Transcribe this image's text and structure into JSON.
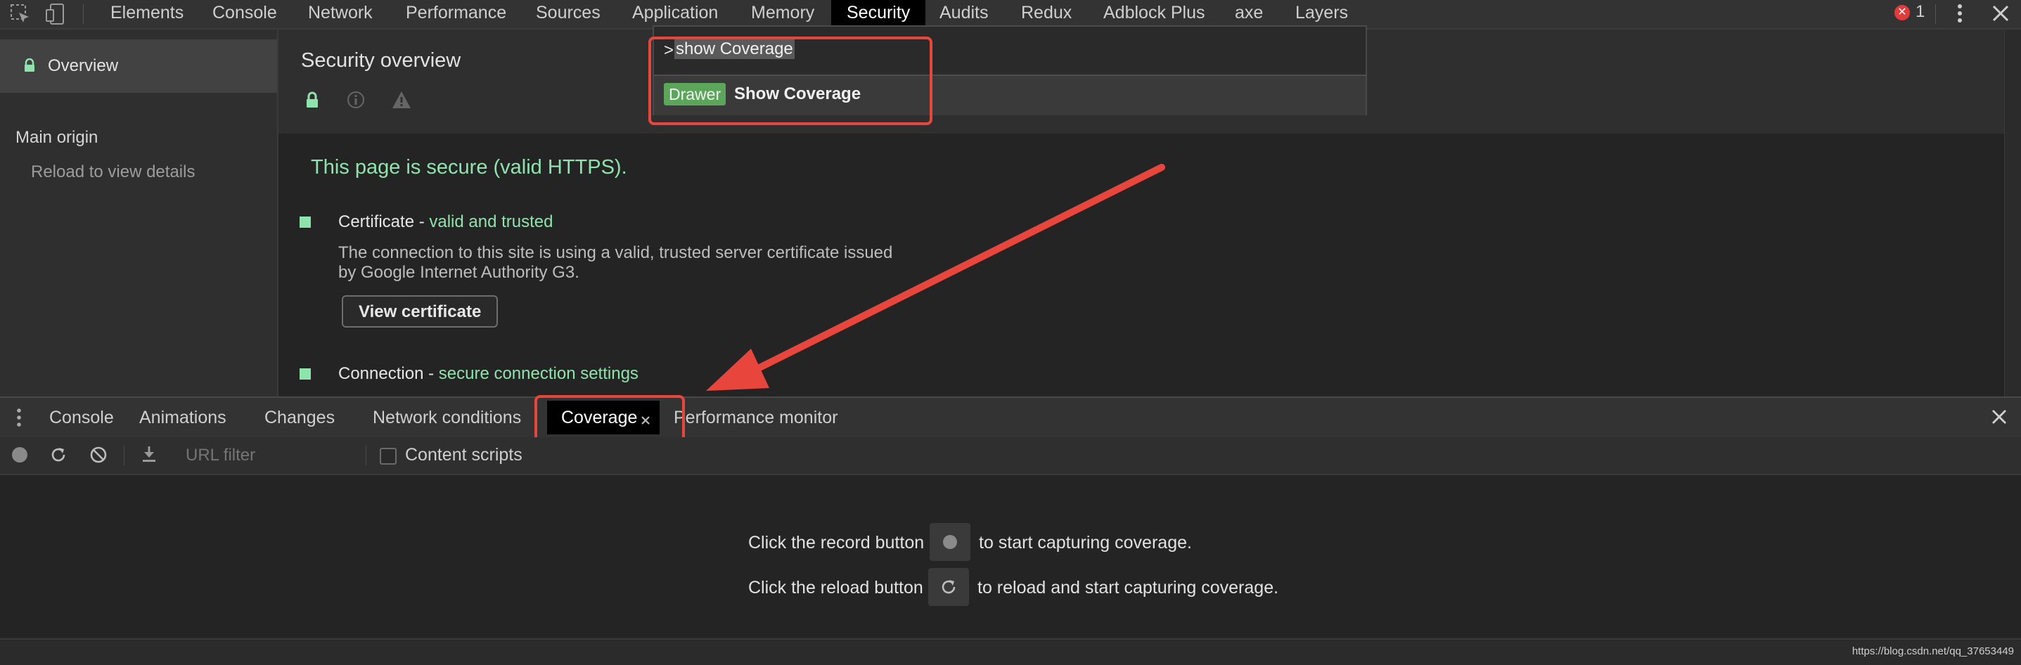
{
  "toolbar": {
    "tabs": [
      "Elements",
      "Console",
      "Network",
      "Performance",
      "Sources",
      "Application",
      "Memory",
      "Security",
      "Audits",
      "Redux",
      "Adblock Plus",
      "axe",
      "Layers"
    ],
    "active_tab": "Security",
    "error_count": "1"
  },
  "sidebar": {
    "overview_label": "Overview",
    "main_origin": "Main origin",
    "reload_hint": "Reload to view details"
  },
  "security": {
    "title": "Security overview",
    "summary": "This page is secure (valid HTTPS).",
    "certificate": {
      "label": "Certificate - ",
      "status": "valid and trusted",
      "description_line1": "The connection to this site is using a valid, trusted server certificate issued",
      "description_line2": "by Google Internet Authority G3.",
      "button": "View certificate"
    },
    "connection": {
      "label": "Connection - ",
      "status": "secure connection settings"
    }
  },
  "command_menu": {
    "prompt": ">",
    "query": "show Coverage",
    "suggestion_badge": "Drawer",
    "suggestion_label": "Show Coverage"
  },
  "drawer": {
    "tabs": [
      "Console",
      "Animations",
      "Changes",
      "Network conditions",
      "Coverage",
      "Performance monitor"
    ],
    "active_tab": "Coverage",
    "url_filter_placeholder": "URL filter",
    "content_scripts_label": "Content scripts",
    "record_text_before": "Click the record button",
    "record_text_after": "to start capturing coverage.",
    "reload_text_before": "Click the reload button",
    "reload_text_after": "to reload and start capturing coverage."
  },
  "watermark": "https://blog.csdn.net/qq_37653449",
  "colors": {
    "secure_green": "#8fe3ad",
    "badge_green": "#5ba65b",
    "highlight_red": "#e8463c",
    "error_red": "#e33b3b"
  }
}
